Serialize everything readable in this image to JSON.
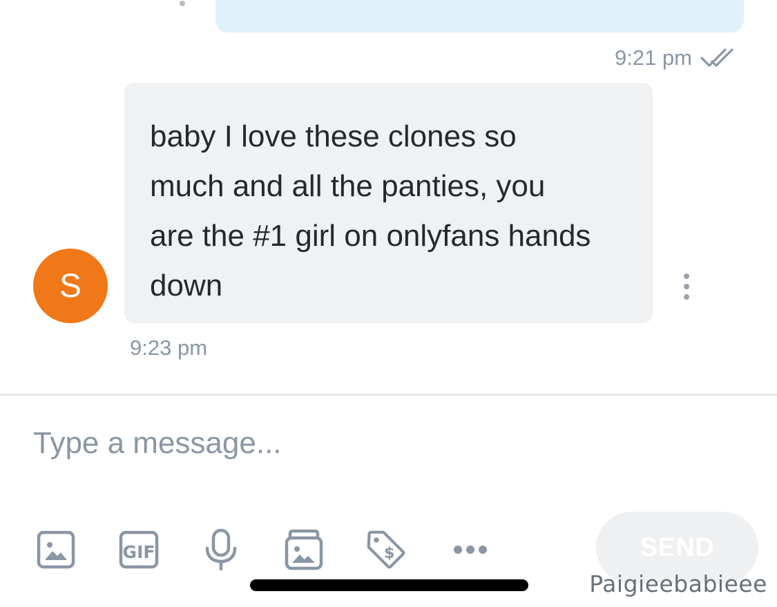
{
  "conversation": {
    "sent_message": {
      "time": "9:21 pm",
      "status_icon": "double-check-icon"
    },
    "received_message": {
      "avatar_initial": "S",
      "avatar_color": "#f07818",
      "text": "baby I love these clones so much and all the panties, you are the #1 girl on onlyfans hands down",
      "time": "9:23 pm",
      "menu_icon": "more-vertical-icon"
    }
  },
  "composer": {
    "placeholder": "Type a message...",
    "value": "",
    "toolbar": [
      {
        "icon": "image-icon"
      },
      {
        "icon": "gif-icon",
        "label": "GIF"
      },
      {
        "icon": "microphone-icon"
      },
      {
        "icon": "vault-media-icon"
      },
      {
        "icon": "price-tag-dollar-icon",
        "label": "$"
      },
      {
        "icon": "more-horizontal-icon"
      }
    ],
    "send_label": "SEND"
  },
  "watermark": "Paigieebabieee",
  "colors": {
    "sent_bubble": "#dff2fb",
    "received_bubble": "#f0f1f3",
    "muted_text": "#8a96a3",
    "icon": "#8a96a3"
  }
}
